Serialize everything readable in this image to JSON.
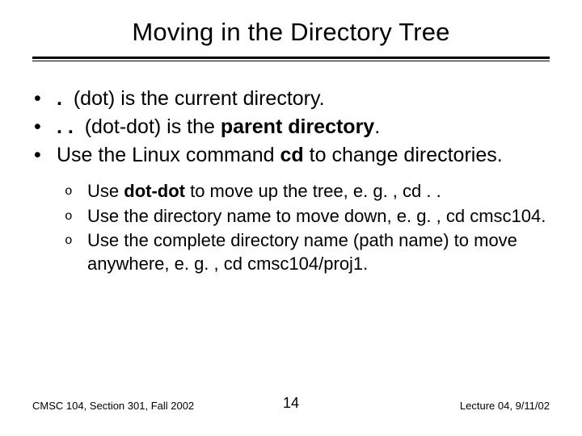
{
  "title": "Moving in the Directory Tree",
  "bullets": {
    "b1": {
      "marker": "•",
      "sym": ".",
      "rest": "  (dot) is the current directory."
    },
    "b2": {
      "marker": "•",
      "sym": ". .",
      "pre": "  (dot-dot) is the ",
      "bold": "parent directory",
      "post": "."
    },
    "b3": {
      "marker": "•",
      "pre": "Use the Linux command ",
      "bold": "cd",
      "post": " to change directories."
    }
  },
  "sub": {
    "s1": {
      "marker": "o",
      "pre": "Use ",
      "bold": "dot-dot",
      "post": " to move up the tree, e. g. , cd . ."
    },
    "s2": {
      "marker": "o",
      "text": "Use the directory name to move down, e. g. , cd cmsc104."
    },
    "s3": {
      "marker": "o",
      "text": "Use the complete directory name (path name) to move anywhere, e. g. , cd cmsc104/proj1."
    }
  },
  "footer": {
    "left": "CMSC 104, Section 301, Fall 2002",
    "center": "14",
    "right": "Lecture 04, 9/11/02"
  }
}
